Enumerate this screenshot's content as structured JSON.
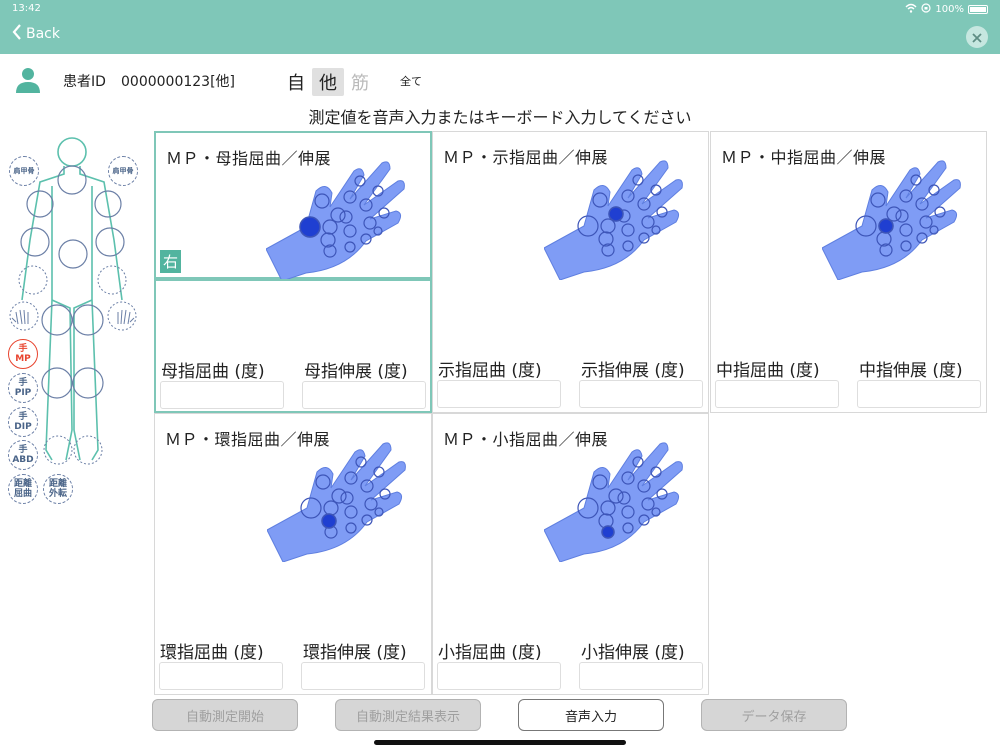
{
  "status_bar": {
    "time": "13:42",
    "battery": "100%"
  },
  "header": {
    "back_label": "Back"
  },
  "patient": {
    "label": "患者ID",
    "id": "0000000123[他]"
  },
  "mode": {
    "self": "自",
    "other": "他",
    "muscle": "筋",
    "all": "全て"
  },
  "instruction": "測定値を音声入力またはキーボード入力してください",
  "body_nav": {
    "shoulder_left": "肩甲骨",
    "shoulder_right": "肩甲骨",
    "hand_mp": [
      "手",
      "MP"
    ],
    "hand_pip": [
      "手",
      "PIP"
    ],
    "hand_dip": [
      "手",
      "DIP"
    ],
    "hand_abd": [
      "手",
      "ABD"
    ],
    "dist_flex": [
      "距離",
      "屈曲"
    ],
    "dist_ext": [
      "距離",
      "外転"
    ]
  },
  "cards": [
    {
      "title": "ＭＰ・母指屈曲／伸展",
      "side": "右",
      "flex_label": "母指屈曲 (度)",
      "ext_label": "母指伸展 (度)"
    },
    {
      "title": "ＭＰ・示指屈曲／伸展",
      "flex_label": "示指屈曲 (度)",
      "ext_label": "示指伸展 (度)"
    },
    {
      "title": "ＭＰ・中指屈曲／伸展",
      "flex_label": "中指屈曲 (度)",
      "ext_label": "中指伸展 (度)"
    },
    {
      "title": "ＭＰ・環指屈曲／伸展",
      "flex_label": "環指屈曲 (度)",
      "ext_label": "環指伸展 (度)"
    },
    {
      "title": "ＭＰ・小指屈曲／伸展",
      "flex_label": "小指屈曲 (度)",
      "ext_label": "小指伸展 (度)"
    }
  ],
  "buttons": {
    "auto_start": "自動測定開始",
    "auto_result": "自動測定結果表示",
    "voice_input": "音声入力",
    "save": "データ保存"
  },
  "colors": {
    "header": "#7fc7b8",
    "accent": "#52b49f",
    "hand": "#7f9cf5",
    "joint_active": "#1f3fd1",
    "active_nav": "#e8442f"
  }
}
